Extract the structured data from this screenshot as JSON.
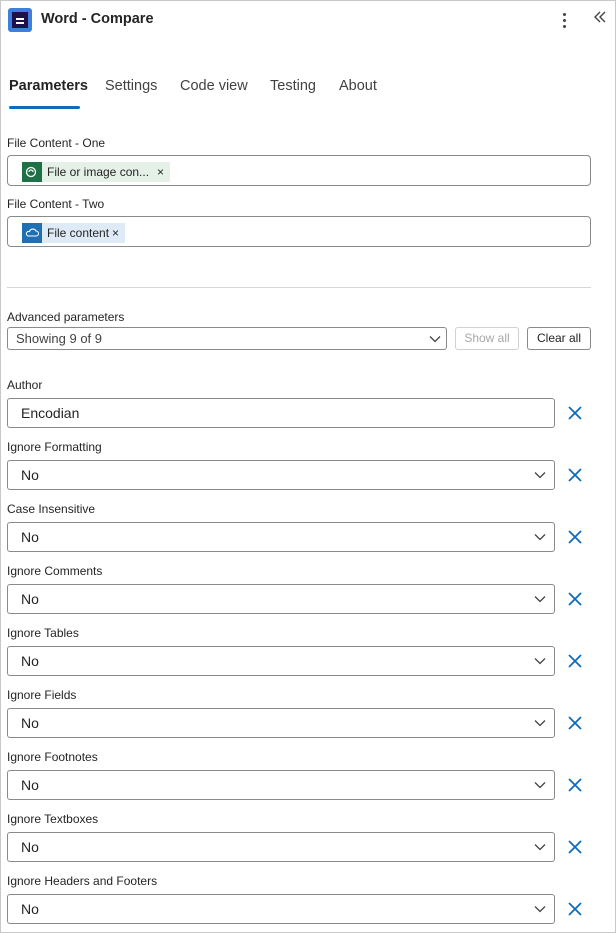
{
  "header": {
    "title": "Word - Compare",
    "logo_icon": "encodian-logo-icon",
    "more_icon": "more-vertical-icon",
    "collapse_icon": "double-chevron-left-icon"
  },
  "tabs": [
    "Parameters",
    "Settings",
    "Code view",
    "Testing",
    "About"
  ],
  "file_content_one": {
    "label": "File Content - One",
    "token": "File or image con...",
    "token_icon": "sharepoint-icon",
    "remove": "×"
  },
  "file_content_two": {
    "label": "File Content - Two",
    "token": "File content",
    "token_icon": "onedrive-cloud-icon",
    "remove": "×"
  },
  "advanced": {
    "label": "Advanced parameters",
    "value": "Showing 9 of 9",
    "show_all": "Show all",
    "clear_all": "Clear all"
  },
  "params": [
    {
      "label": "Author",
      "value": "Encodian",
      "type": "text"
    },
    {
      "label": "Ignore Formatting",
      "value": "No",
      "type": "select"
    },
    {
      "label": "Case Insensitive",
      "value": "No",
      "type": "select"
    },
    {
      "label": "Ignore Comments",
      "value": "No",
      "type": "select"
    },
    {
      "label": "Ignore Tables",
      "value": "No",
      "type": "select"
    },
    {
      "label": "Ignore Fields",
      "value": "No",
      "type": "select"
    },
    {
      "label": "Ignore Footnotes",
      "value": "No",
      "type": "select"
    },
    {
      "label": "Ignore Textboxes",
      "value": "No",
      "type": "select"
    },
    {
      "label": "Ignore Headers and Footers",
      "value": "No",
      "type": "select"
    }
  ],
  "colors": {
    "accent": "#0f6cbd",
    "token_green": "#e5f1e7",
    "token_blue": "#dfeaf7",
    "sharepoint": "#1e7145",
    "onedrive": "#1f6fb5"
  }
}
